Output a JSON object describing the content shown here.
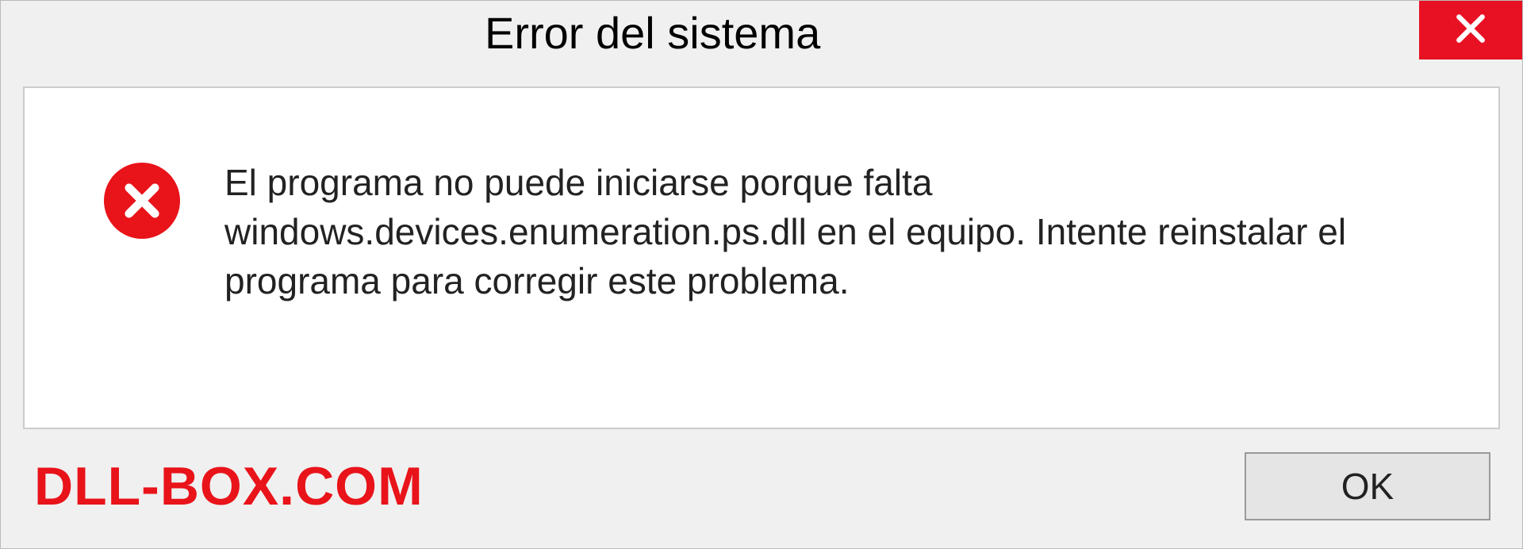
{
  "titlebar": {
    "title": "Error del sistema"
  },
  "content": {
    "message": "El programa no puede iniciarse porque falta windows.devices.enumeration.ps.dll en el equipo. Intente reinstalar el programa para corregir este problema."
  },
  "footer": {
    "watermark": "DLL-BOX.COM",
    "ok_label": "OK"
  },
  "colors": {
    "close_red": "#e81123",
    "icon_red": "#e9131a",
    "watermark_red": "#e9131a"
  }
}
